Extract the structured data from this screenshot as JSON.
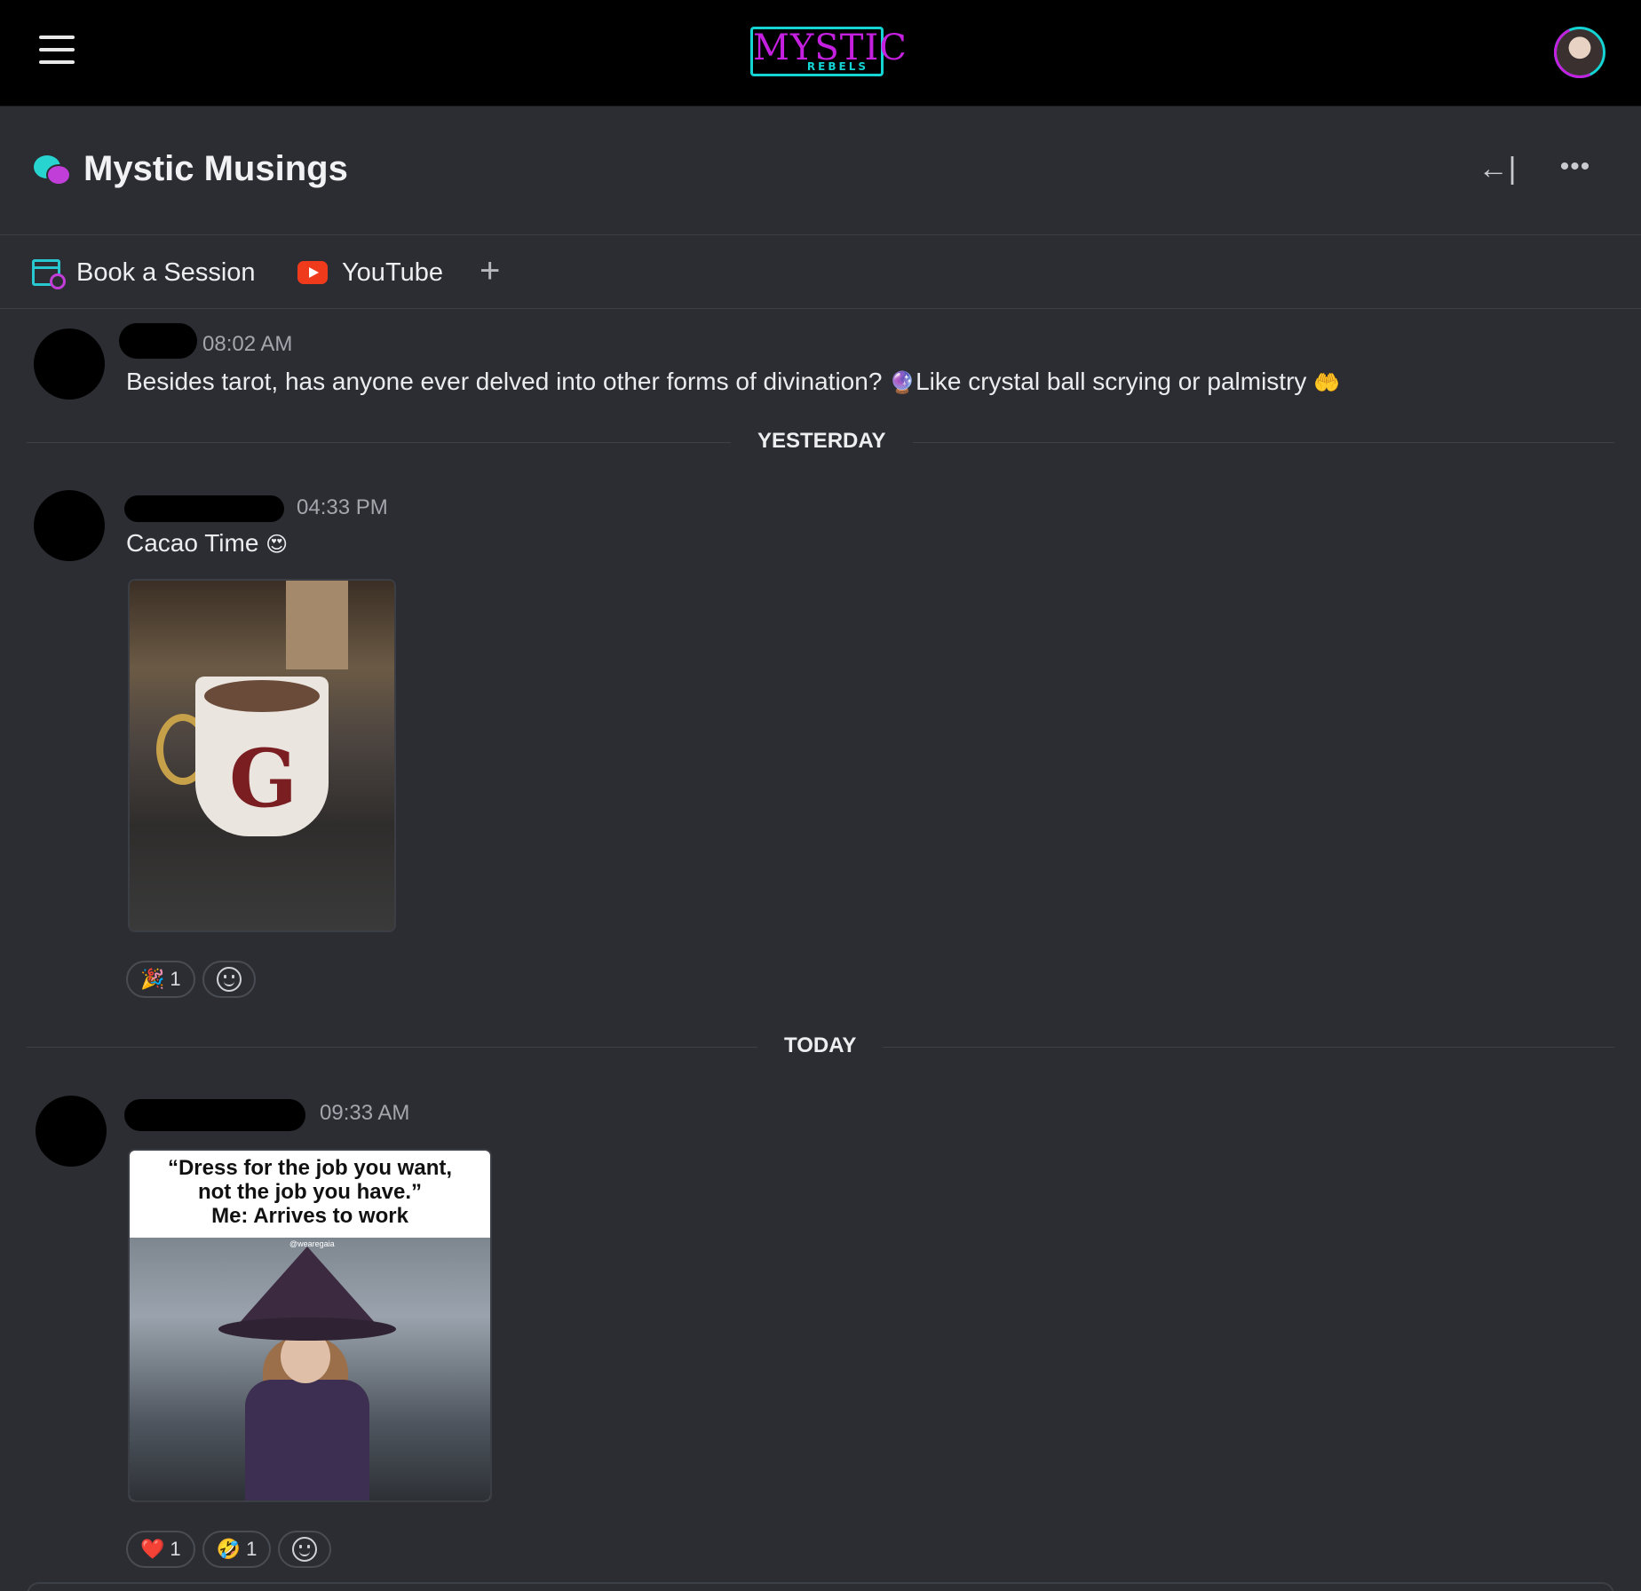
{
  "header": {
    "logo_main": "MYSTIC",
    "logo_sub": "REBELS",
    "menu_icon": "hamburger-icon",
    "profile_icon": "user-avatar"
  },
  "channel": {
    "title": "Mystic Musings",
    "icon": "chat-bubbles-icon",
    "collapse_glyph": "←|",
    "more_glyph": "•••"
  },
  "tabs": [
    {
      "label": "Book a Session",
      "icon": "calendar-clock-icon"
    },
    {
      "label": "YouTube",
      "icon": "youtube-icon"
    }
  ],
  "add_tab_glyph": "+",
  "messages": [
    {
      "time": "08:02 AM",
      "text_before": "Besides tarot, has anyone ever delved into other forms of divination? ",
      "emoji1": "🔮",
      "text_after": "Like crystal ball scrying or palmistry ",
      "emoji2": "🤲"
    },
    {
      "time": "04:33 PM",
      "text": "Cacao Time ",
      "emoji": "😍",
      "reactions": [
        {
          "emoji": "🎉",
          "count": "1"
        }
      ]
    },
    {
      "time": "09:33 AM",
      "meme_caption": [
        "“Dress for the job you want,",
        "not the job you have.”",
        "Me: Arrives to work"
      ],
      "meme_handle": "@wearegaia",
      "reactions": [
        {
          "emoji": "❤️",
          "count": "1"
        },
        {
          "emoji": "🤣",
          "count": "1"
        }
      ]
    }
  ],
  "dividers": [
    "YESTERDAY",
    "TODAY"
  ]
}
